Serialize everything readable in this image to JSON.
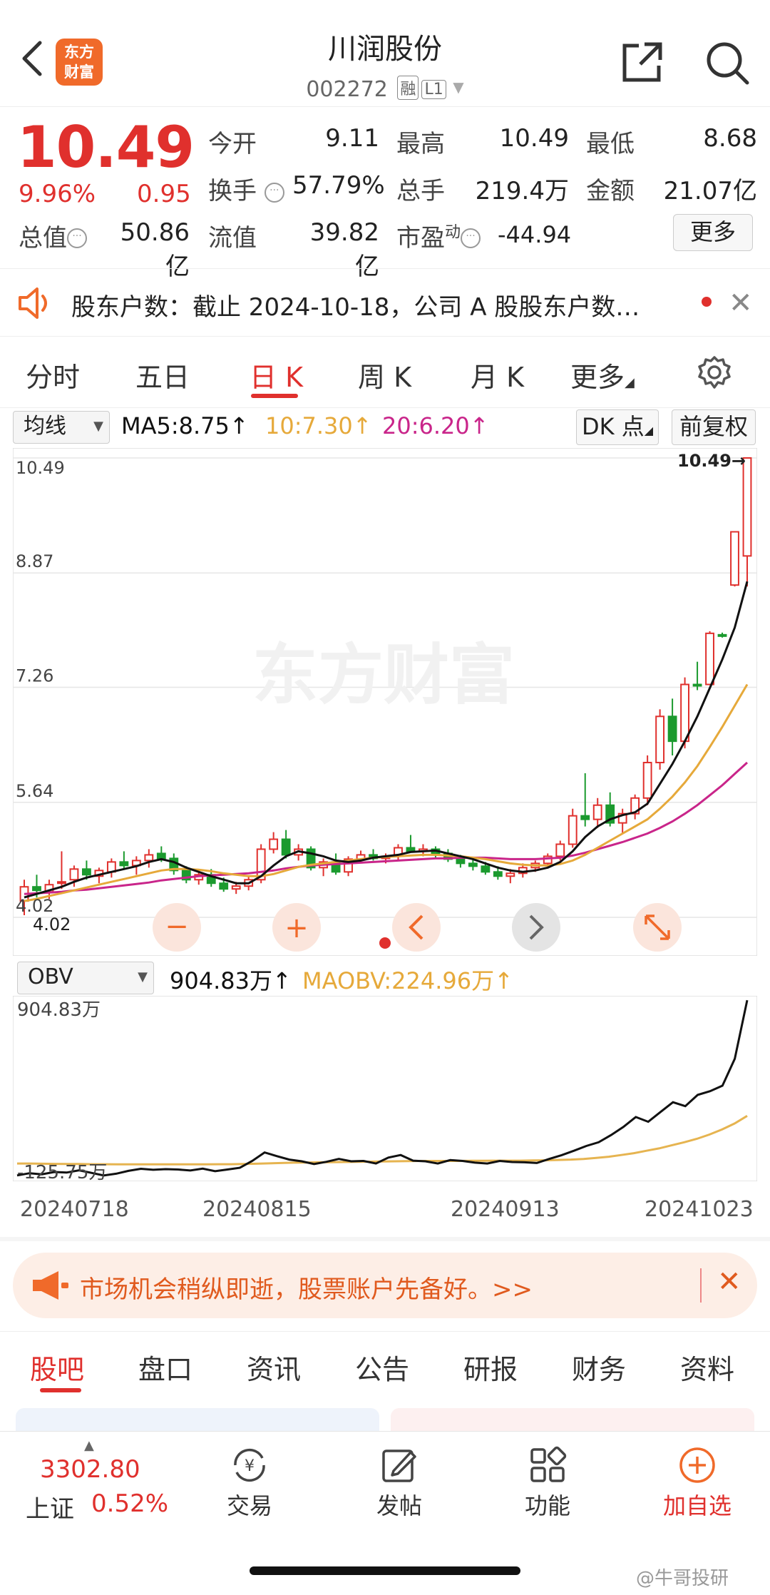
{
  "header": {
    "logo_line1": "东方",
    "logo_line2": "财富",
    "title": "川润股份",
    "code": "002272",
    "tag1": "融",
    "tag2": "L1"
  },
  "quote": {
    "price": "10.49",
    "pct": "9.96%",
    "change": "0.95",
    "rows": [
      [
        {
          "label": "今开",
          "value": "9.11",
          "color": "green"
        },
        {
          "label": "最高",
          "value": "10.49",
          "color": "red"
        },
        {
          "label": "最低",
          "value": "8.68",
          "color": "green"
        }
      ],
      [
        {
          "label": "换手",
          "value": "57.79%",
          "color": "dark"
        },
        {
          "label": "总手",
          "value": "219.4万",
          "color": "dark"
        },
        {
          "label": "金额",
          "value": "21.07亿",
          "color": "dark"
        }
      ]
    ],
    "total_value_label": "总值",
    "total_value": "50.86亿",
    "float_label": "流值",
    "float_value": "39.82亿",
    "pe_label": "市盈",
    "pe_super": "动",
    "pe_value": "-44.94",
    "more_label": "更多"
  },
  "notice": {
    "text": "股东户数：截止 2024-10-18，公司 A 股股东户数…"
  },
  "tabs": [
    "分时",
    "五日",
    "日 K",
    "周 K",
    "月 K",
    "更多"
  ],
  "active_tab": 2,
  "ma_bar": {
    "select_label": "均线",
    "ma5": "MA5:8.75↑",
    "ma10": "10:7.30↑",
    "ma20": "20:6.20↑",
    "dk_label": "DK 点",
    "adj_label": "前复权"
  },
  "kline_axis": {
    "labels": [
      "10.49",
      "8.87",
      "7.26",
      "5.64",
      "4.02"
    ],
    "last_price_tag": "10.49→",
    "low_tag": "4.02"
  },
  "kline_watermark": "东方财富",
  "obv_bar": {
    "select_label": "OBV",
    "obv": "904.83万↑",
    "maobv": "MAOBV:224.96万↑",
    "top_label": "904.83万",
    "bottom_label": "-125.75万"
  },
  "dates": [
    "20240718",
    "20240815",
    "20240913",
    "20241023"
  ],
  "chart_data": {
    "type": "candlestick",
    "series_names": [
      "MA5",
      "MA10",
      "MA20"
    ],
    "y_range": [
      4.02,
      10.49
    ],
    "ohlc": [
      [
        4.25,
        4.55,
        4.05,
        4.45
      ],
      [
        4.45,
        4.62,
        4.3,
        4.4
      ],
      [
        4.38,
        4.55,
        4.28,
        4.48
      ],
      [
        4.5,
        4.95,
        4.42,
        4.52
      ],
      [
        4.55,
        4.75,
        4.45,
        4.7
      ],
      [
        4.7,
        4.82,
        4.55,
        4.62
      ],
      [
        4.6,
        4.72,
        4.5,
        4.68
      ],
      [
        4.66,
        4.85,
        4.58,
        4.8
      ],
      [
        4.8,
        4.95,
        4.7,
        4.75
      ],
      [
        4.75,
        4.88,
        4.62,
        4.82
      ],
      [
        4.82,
        4.98,
        4.72,
        4.9
      ],
      [
        4.92,
        5.02,
        4.8,
        4.85
      ],
      [
        4.85,
        4.92,
        4.62,
        4.68
      ],
      [
        4.68,
        4.74,
        4.5,
        4.55
      ],
      [
        4.55,
        4.68,
        4.48,
        4.62
      ],
      [
        4.62,
        4.7,
        4.45,
        4.5
      ],
      [
        4.5,
        4.58,
        4.38,
        4.42
      ],
      [
        4.42,
        4.52,
        4.35,
        4.46
      ],
      [
        4.46,
        4.6,
        4.4,
        4.55
      ],
      [
        4.55,
        5.05,
        4.5,
        4.98
      ],
      [
        4.98,
        5.22,
        4.92,
        5.12
      ],
      [
        5.12,
        5.25,
        4.85,
        4.9
      ],
      [
        4.9,
        5.05,
        4.82,
        4.98
      ],
      [
        4.98,
        5.02,
        4.68,
        4.72
      ],
      [
        4.72,
        4.85,
        4.6,
        4.8
      ],
      [
        4.8,
        4.92,
        4.62,
        4.66
      ],
      [
        4.66,
        4.88,
        4.6,
        4.84
      ],
      [
        4.84,
        4.96,
        4.78,
        4.9
      ],
      [
        4.9,
        4.98,
        4.82,
        4.85
      ],
      [
        4.85,
        4.92,
        4.78,
        4.88
      ],
      [
        4.88,
        5.05,
        4.82,
        5.0
      ],
      [
        5.0,
        5.18,
        4.95,
        4.95
      ],
      [
        4.95,
        5.05,
        4.88,
        4.98
      ],
      [
        4.98,
        5.02,
        4.86,
        4.92
      ],
      [
        4.92,
        4.98,
        4.8,
        4.84
      ],
      [
        4.84,
        4.9,
        4.72,
        4.78
      ],
      [
        4.78,
        4.85,
        4.68,
        4.74
      ],
      [
        4.74,
        4.8,
        4.62,
        4.66
      ],
      [
        4.66,
        4.74,
        4.55,
        4.6
      ],
      [
        4.6,
        4.7,
        4.5,
        4.64
      ],
      [
        4.64,
        4.78,
        4.58,
        4.72
      ],
      [
        4.72,
        4.82,
        4.66,
        4.78
      ],
      [
        4.78,
        4.92,
        4.72,
        4.88
      ],
      [
        4.88,
        5.1,
        4.82,
        5.05
      ],
      [
        5.05,
        5.55,
        5.0,
        5.45
      ],
      [
        5.45,
        6.05,
        5.3,
        5.4
      ],
      [
        5.4,
        5.7,
        5.28,
        5.6
      ],
      [
        5.6,
        5.78,
        5.3,
        5.35
      ],
      [
        5.35,
        5.55,
        5.2,
        5.48
      ],
      [
        5.48,
        5.75,
        5.4,
        5.7
      ],
      [
        5.7,
        6.3,
        5.6,
        6.2
      ],
      [
        6.2,
        6.95,
        6.1,
        6.85
      ],
      [
        6.85,
        7.1,
        6.3,
        6.5
      ],
      [
        6.5,
        7.4,
        6.4,
        7.3
      ],
      [
        7.3,
        7.62,
        7.22,
        7.28
      ],
      [
        7.3,
        8.05,
        8.0,
        8.02
      ],
      [
        8.0,
        8.03,
        7.96,
        7.98
      ],
      [
        8.7,
        9.45,
        8.68,
        9.45
      ],
      [
        9.11,
        10.49,
        8.68,
        10.49
      ]
    ],
    "ma5": [
      4.3,
      4.35,
      4.4,
      4.45,
      4.52,
      4.58,
      4.62,
      4.66,
      4.7,
      4.74,
      4.8,
      4.84,
      4.8,
      4.72,
      4.66,
      4.6,
      4.55,
      4.5,
      4.5,
      4.6,
      4.75,
      4.88,
      4.95,
      4.92,
      4.88,
      4.82,
      4.8,
      4.82,
      4.86,
      4.88,
      4.9,
      4.94,
      4.95,
      4.96,
      4.92,
      4.88,
      4.84,
      4.78,
      4.72,
      4.68,
      4.66,
      4.68,
      4.72,
      4.8,
      4.95,
      5.15,
      5.3,
      5.4,
      5.46,
      5.5,
      5.62,
      5.9,
      6.18,
      6.5,
      6.85,
      7.25,
      7.65,
      8.1,
      8.75
    ],
    "ma10": [
      4.25,
      4.28,
      4.32,
      4.36,
      4.4,
      4.44,
      4.48,
      4.52,
      4.56,
      4.6,
      4.64,
      4.68,
      4.7,
      4.7,
      4.69,
      4.67,
      4.64,
      4.62,
      4.6,
      4.6,
      4.63,
      4.68,
      4.73,
      4.76,
      4.78,
      4.8,
      4.82,
      4.84,
      4.86,
      4.87,
      4.88,
      4.89,
      4.9,
      4.9,
      4.89,
      4.88,
      4.86,
      4.84,
      4.81,
      4.78,
      4.76,
      4.75,
      4.75,
      4.77,
      4.82,
      4.9,
      5.0,
      5.1,
      5.2,
      5.3,
      5.4,
      5.55,
      5.72,
      5.92,
      6.15,
      6.42,
      6.7,
      7.0,
      7.3
    ],
    "ma20": [
      4.35,
      4.36,
      4.37,
      4.38,
      4.4,
      4.41,
      4.43,
      4.45,
      4.47,
      4.49,
      4.51,
      4.54,
      4.56,
      4.58,
      4.6,
      4.61,
      4.62,
      4.63,
      4.64,
      4.66,
      4.68,
      4.71,
      4.73,
      4.75,
      4.76,
      4.77,
      4.78,
      4.79,
      4.8,
      4.81,
      4.82,
      4.83,
      4.84,
      4.85,
      4.85,
      4.86,
      4.86,
      4.86,
      4.85,
      4.84,
      4.84,
      4.84,
      4.85,
      4.86,
      4.89,
      4.93,
      4.98,
      5.03,
      5.08,
      5.14,
      5.2,
      5.28,
      5.37,
      5.48,
      5.6,
      5.74,
      5.88,
      6.04,
      6.2
    ],
    "obv_range": [
      -125.75,
      904.83
    ],
    "obv": [
      -125,
      -112,
      -118,
      -105,
      -108,
      -95,
      -110,
      -125,
      -115,
      -98,
      -86,
      -92,
      -88,
      -90,
      -96,
      -85,
      -100,
      -90,
      -80,
      -40,
      10,
      -12,
      -32,
      -42,
      -58,
      -45,
      -28,
      -42,
      -40,
      -55,
      -20,
      -5,
      -38,
      -42,
      -55,
      -35,
      -40,
      -50,
      -55,
      -40,
      -46,
      -48,
      -52,
      -28,
      -6,
      20,
      48,
      70,
      112,
      160,
      218,
      190,
      248,
      305,
      282,
      348,
      370,
      402,
      560,
      904
    ],
    "maobv": [
      -55,
      -55,
      -56,
      -57,
      -58,
      -58,
      -59,
      -59,
      -60,
      -60,
      -60,
      -60,
      -60,
      -60,
      -60,
      -60,
      -59,
      -59,
      -58,
      -56,
      -54,
      -52,
      -50,
      -49,
      -48,
      -47,
      -46,
      -45,
      -44,
      -43,
      -42,
      -41,
      -40,
      -40,
      -40,
      -40,
      -39,
      -39,
      -38,
      -38,
      -38,
      -37,
      -36,
      -34,
      -32,
      -28,
      -22,
      -15,
      -5,
      6,
      20,
      34,
      52,
      70,
      90,
      115,
      145,
      180,
      224.96
    ]
  },
  "banner": {
    "text": "市场机会稍纵即逝，股票账户先备好。>>"
  },
  "bottom_tabs": [
    "股吧",
    "盘口",
    "资讯",
    "公告",
    "研报",
    "财务",
    "资料"
  ],
  "bottom_nav": {
    "index_value": "3302.80",
    "index_name": "上证",
    "index_pct": "0.52%",
    "items": [
      "交易",
      "发帖",
      "功能",
      "加自选"
    ]
  },
  "watermark": "@牛哥投研"
}
